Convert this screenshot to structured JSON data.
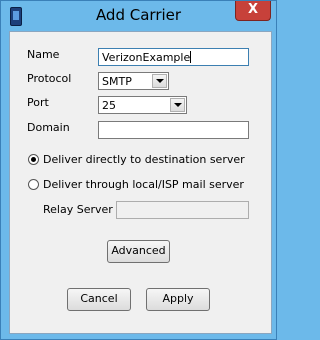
{
  "window": {
    "title": "Add Carrier",
    "close_glyph": "X"
  },
  "form": {
    "name_label": "Name",
    "name_value": "VerizonExample",
    "protocol_label": "Protocol",
    "protocol_value": "SMTP",
    "port_label": "Port",
    "port_value": "25",
    "domain_label": "Domain",
    "domain_value": "",
    "radio_direct_label": "Deliver directly to destination server",
    "radio_direct_selected": true,
    "radio_isp_label": "Deliver through local/ISP mail server",
    "radio_isp_selected": false,
    "relay_label": "Relay Server",
    "relay_value": ""
  },
  "buttons": {
    "advanced": "Advanced",
    "cancel": "Cancel",
    "apply": "Apply"
  },
  "icons": {
    "app": "phone-icon",
    "close": "close-icon",
    "dropdown": "chevron-down-icon"
  }
}
